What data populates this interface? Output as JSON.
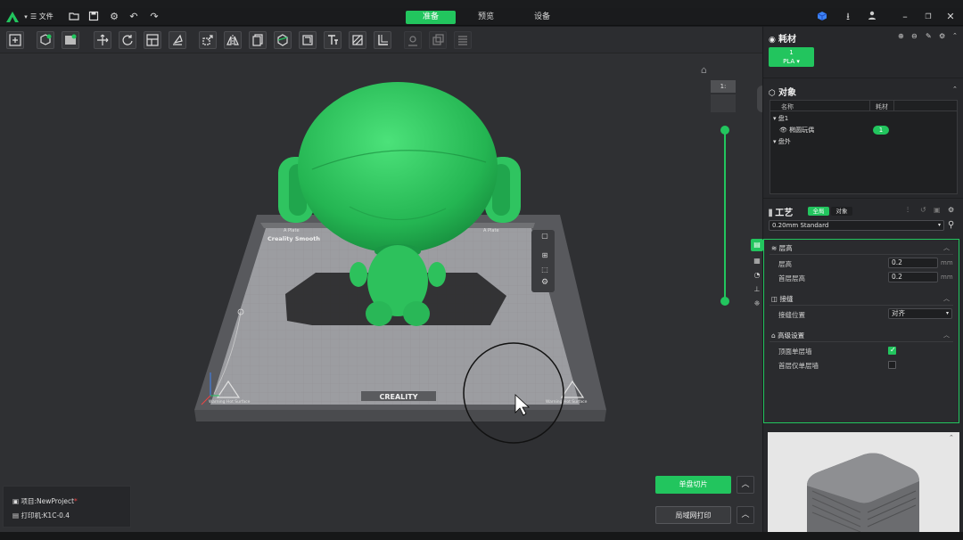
{
  "colors": {
    "accent": "#22c55e",
    "background": "#2f3033",
    "panel": "#27282b"
  },
  "titlebar": {
    "file_menu": "文件",
    "tabs": [
      {
        "label": "准备",
        "active": true
      },
      {
        "label": "预览",
        "active": false
      },
      {
        "label": "设备",
        "active": false
      }
    ]
  },
  "toolbar": {
    "icons": [
      "add-plate-icon",
      "add-model-icon",
      "add-image-icon",
      "move-icon",
      "rotate-icon",
      "arrange-icon",
      "auto-orient-icon",
      "scale-icon",
      "mirror-icon",
      "copy-icon",
      "cut-icon",
      "split-icon",
      "text-icon",
      "paint-icon",
      "support-paint-icon",
      "seam-icon",
      "assembly-icon",
      "layers-icon"
    ]
  },
  "viewport": {
    "plate_labels": [
      "Creality Smooth",
      "A Plate",
      "A Plate"
    ],
    "brand": "CREALITY",
    "left_warning": "Warning Hot Surface",
    "right_warning": "Warning Hot Surface",
    "view_badge": "1:"
  },
  "filament": {
    "title": "耗材",
    "slot_number": "1",
    "slot_type": "PLA"
  },
  "objects": {
    "title": "对象",
    "col_name": "名称",
    "col_filament": "耗材",
    "tree": [
      {
        "label": "盘1",
        "level": 0
      },
      {
        "label": "椭圆玩偶",
        "level": 1,
        "filament": "1"
      },
      {
        "label": "盘外",
        "level": 0
      }
    ]
  },
  "process": {
    "title": "工艺",
    "tab_global": "全局",
    "tab_object": "对象",
    "preset": "0.20mm Standard",
    "sections": [
      {
        "title": "层高",
        "rows": [
          {
            "label": "层高",
            "value": "0.2",
            "unit": "mm"
          },
          {
            "label": "首层层高",
            "value": "0.2",
            "unit": "mm"
          }
        ]
      },
      {
        "title": "接缝",
        "rows": [
          {
            "label": "接缝位置",
            "value": "对齐"
          }
        ]
      },
      {
        "title": "高级设置",
        "rows": [
          {
            "label": "顶面单层墙",
            "checked": true
          },
          {
            "label": "首层仅单层墙",
            "checked": false
          }
        ]
      }
    ]
  },
  "project": {
    "project_label": "项目:NewProject",
    "printer_label": "打印机:K1C-0.4"
  },
  "actions": {
    "slice_label": "单盘切片",
    "print_label": "局域网打印"
  }
}
